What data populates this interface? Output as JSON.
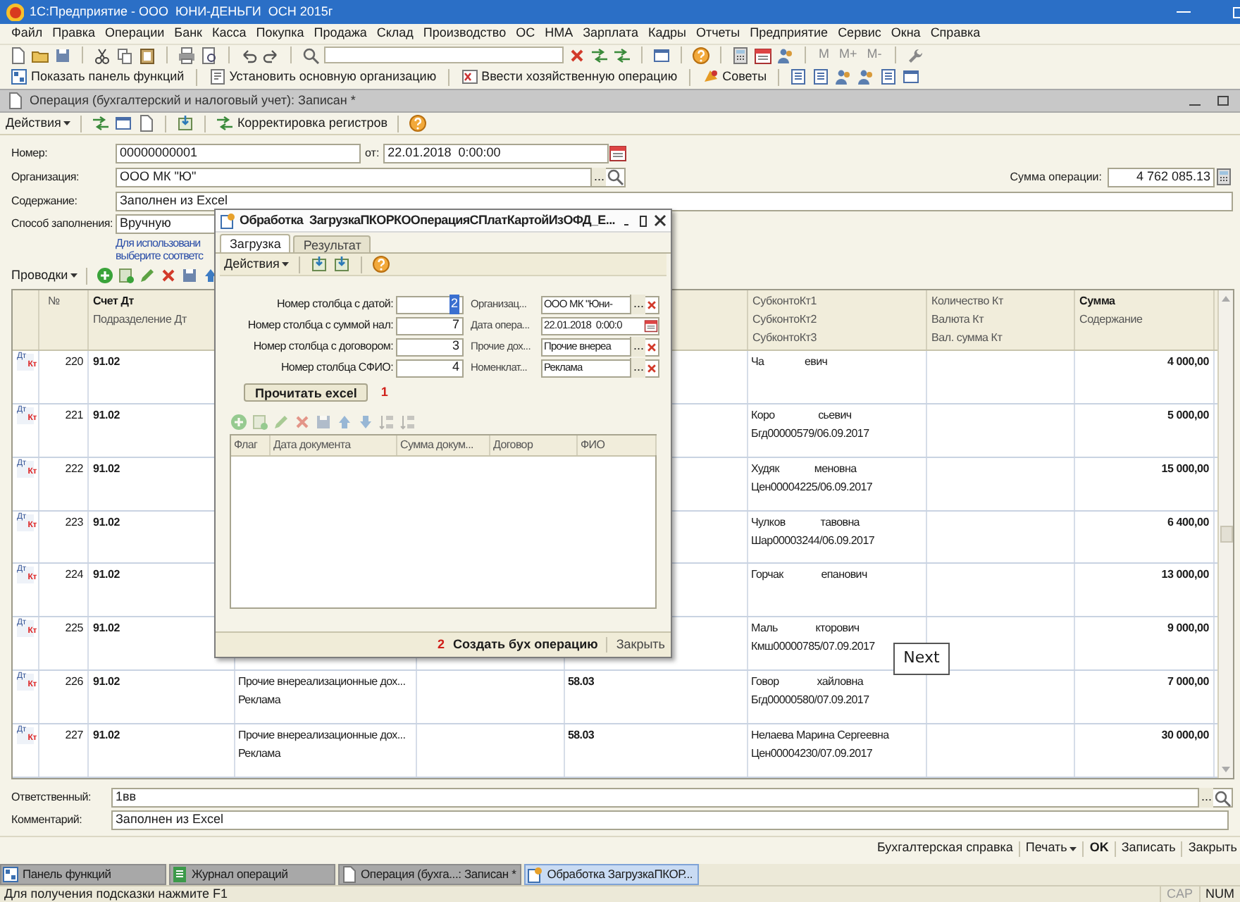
{
  "window": {
    "title": "1С:Предприятие - ООО  ЮНИ-ДЕНЬГИ  ОСН 2015г"
  },
  "menu": [
    "Файл",
    "Правка",
    "Операции",
    "Банк",
    "Касса",
    "Покупка",
    "Продажа",
    "Склад",
    "Производство",
    "ОС",
    "НМА",
    "Зарплата",
    "Кадры",
    "Отчеты",
    "Предприятие",
    "Сервис",
    "Окна",
    "Справка"
  ],
  "memory_buttons": [
    "M",
    "M+",
    "M-"
  ],
  "command_bar": [
    {
      "label": "Показать панель функций",
      "kind": "panel"
    },
    {
      "label": "Установить основную организацию",
      "kind": "org"
    },
    {
      "label": "Ввести хозяйственную операцию",
      "kind": "operation"
    },
    {
      "label": "Советы",
      "kind": "tips"
    }
  ],
  "document": {
    "title": "Операция (бухгалтерский и налоговый учет): Записан *",
    "actions": "Действия",
    "correct": "Корректировка регистров",
    "number_label": "Номер:",
    "number": "00000000001",
    "date_label": "от:",
    "date": "22.01.2018  0:00:00",
    "org_label": "Организация:",
    "org": "ООО МК \"Ю\"",
    "org_button": "...",
    "sum_label": "Сумма операции:",
    "sum": "4 762 085.13",
    "content_label": "Содержание:",
    "content": "Заполнен из Excel",
    "fill_label": "Способ заполнения:",
    "fill": "Вручную",
    "hint_lines": [
      "Для использовани",
      "выберите соответс"
    ],
    "entries_label": "Проводки",
    "table": {
      "columns": {
        "number": [
          "№"
        ],
        "account_dt": [
          "Счет Дт",
          "Подразделение Дт"
        ],
        "subkonto_kt": [
          "СубконтоКт1",
          "СубконтоКт2",
          "СубконтоКт3"
        ],
        "quantity_kt": [
          "Количество Кт",
          "Валюта Кт",
          "Вал. сумма Кт"
        ],
        "sum": [
          "Сумма",
          "Содержание"
        ]
      },
      "rows": [
        {
          "dt": "Дт",
          "kt": "Кт",
          "number": "220",
          "account_dt": "91.02",
          "subkonto_kt": [
            "Ча               евич"
          ],
          "sum": "4 000,00"
        },
        {
          "dt": "Дт",
          "kt": "Кт",
          "number": "221",
          "account_dt": "91.02",
          "subkonto_kt": [
            "Коро                сьевич",
            "Бгд00000579/06.09.2017"
          ],
          "sum": "5 000,00"
        },
        {
          "dt": "Дт",
          "kt": "Кт",
          "number": "222",
          "account_dt": "91.02",
          "subkonto_kt": [
            "Худяк             меновна",
            "Цен00004225/06.09.2017"
          ],
          "sum": "15 000,00"
        },
        {
          "dt": "Дт",
          "kt": "Кт",
          "number": "223",
          "account_dt": "91.02",
          "subkonto_kt": [
            "Чулков             тавовна",
            "Шар00003244/06.09.2017"
          ],
          "sum": "6 400,00"
        },
        {
          "dt": "Дт",
          "kt": "Кт",
          "number": "224",
          "account_dt": "91.02",
          "subkonto_kt": [
            "Горчак              епанович"
          ],
          "sum": "13 000,00"
        },
        {
          "dt": "Дт",
          "kt": "Кт",
          "number": "225",
          "account_dt": "91.02",
          "subkonto_kt": [
            "Маль              кторович",
            "Кмш00000785/07.09.2017"
          ],
          "sum": "9 000,00"
        },
        {
          "dt": "Дт",
          "kt": "Кт",
          "number": "226",
          "account_dt": "91.02",
          "column_3": [
            "Прочие внереализационные дох...",
            "Реклама"
          ],
          "column_5": [
            "58.03"
          ],
          "subkonto_kt": [
            "Говор              хайловна",
            "Бгд00000580/07.09.2017"
          ],
          "sum": "7 000,00"
        },
        {
          "dt": "Дт",
          "kt": "Кт",
          "number": "227",
          "account_dt": "91.02",
          "column_3": [
            "Прочие внереализационные дох...",
            "Реклама"
          ],
          "column_5": [
            "58.03"
          ],
          "subkonto_kt": [
            "Нелаева Марина Сергеевна",
            "Цен00004230/07.09.2017"
          ],
          "sum": "30 000,00"
        }
      ]
    },
    "responsible_label": "Ответственный:",
    "responsible": "1вв",
    "responsible_button": "...",
    "comment_label": "Комментарий:",
    "comment": "Заполнен из Excel",
    "buttons": [
      {
        "label": "Бухгалтерская справка",
        "kind": "plain"
      },
      {
        "label": "Печать",
        "kind": "menu"
      },
      {
        "label": "OK",
        "kind": "default"
      },
      {
        "label": "Записать",
        "kind": "plain"
      },
      {
        "label": "Закрыть",
        "kind": "plain"
      }
    ]
  },
  "dialog": {
    "title": "Обработка  ЗагрузкаПКОРКООперацияСПлатКартойИзОФД_Е...",
    "tabs": [
      {
        "label": "Загрузка",
        "selected": true
      },
      {
        "label": "Результат",
        "selected": false
      }
    ],
    "actions": "Действия",
    "params_left": [
      {
        "label": "Номер столбца с датой:",
        "value": "2",
        "highlighted": true
      },
      {
        "label": "Номер столбца с суммой нал:",
        "value": "7",
        "highlighted": false
      },
      {
        "label": "Номер столбца с договором:",
        "value": "3",
        "highlighted": false
      },
      {
        "label": "Номер столбца СФИО:",
        "value": "4",
        "highlighted": false
      }
    ],
    "params_right": [
      {
        "label": "Организац...",
        "value": "ООО МК \"Юни-",
        "kind": "ref",
        "button": "..."
      },
      {
        "label": "Дата опера...",
        "value": "22.01.2018  0:00:0",
        "kind": "date"
      },
      {
        "label": "Прочие дох...",
        "value": "Прочие внереа",
        "kind": "ref",
        "button": "..."
      },
      {
        "label": "Номенклат...",
        "value": "Реклама",
        "kind": "ref",
        "button": "..."
      }
    ],
    "read_button": "Прочитать excel",
    "read_marker": "1",
    "columns": [
      "Флаг",
      "Дата документа",
      "Сумма докум...",
      "Договор",
      "ФИО"
    ],
    "create_marker": "2",
    "create_button": "Создать бух операцию",
    "close_button": "Закрыть"
  },
  "annotation": {
    "text": "Next"
  },
  "taskbar": [
    {
      "label": "Панель функций",
      "selected": false,
      "kind": "panel"
    },
    {
      "label": "Журнал операций",
      "selected": false,
      "kind": "journal"
    },
    {
      "label": "Операция (бухга...: Записан *",
      "selected": false,
      "kind": "document"
    },
    {
      "label": "Обработка  ЗагрузкаПКОР...",
      "selected": true,
      "kind": "processing"
    }
  ],
  "status_bar": {
    "text": "Для получения подсказки нажмите F1",
    "indicators": [
      "CAP",
      "NUM"
    ]
  }
}
